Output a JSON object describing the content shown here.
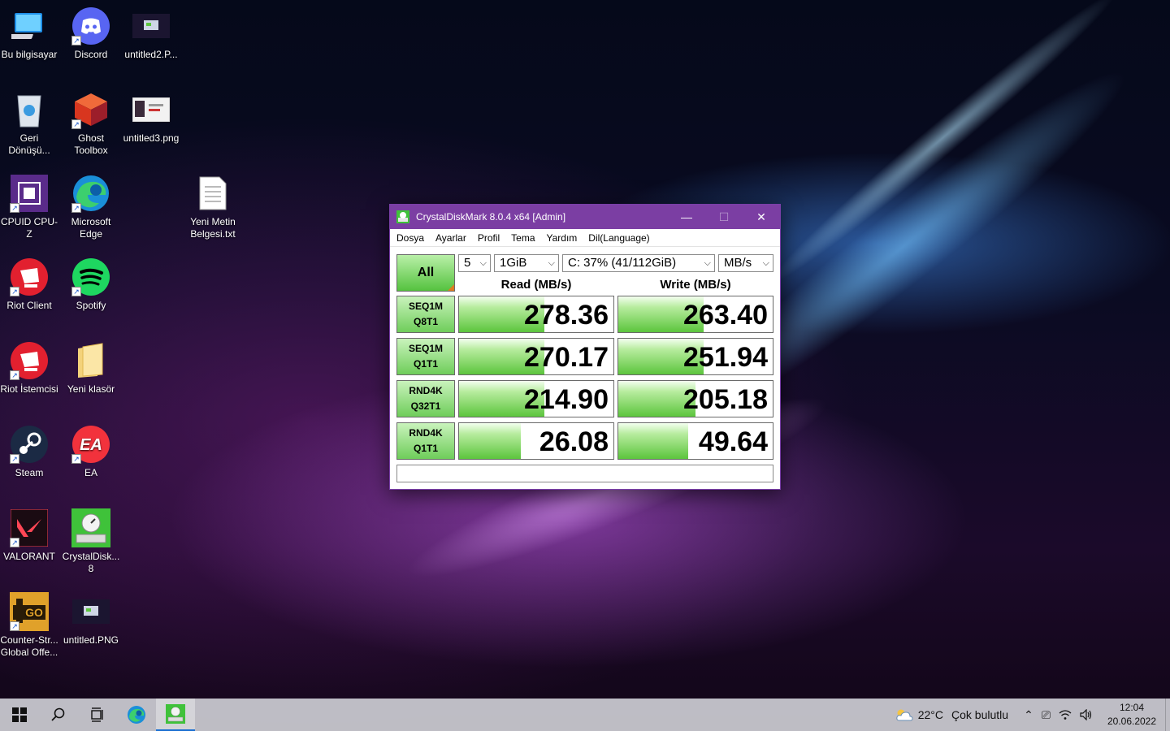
{
  "desktop": {
    "icons": [
      {
        "label": "Bu bilgisayar"
      },
      {
        "label": "Discord"
      },
      {
        "label": "untitled2.P..."
      },
      {
        "label": "Geri Dönüşü..."
      },
      {
        "label": "Ghost Toolbox"
      },
      {
        "label": "untitled3.png"
      },
      {
        "label": "CPUID CPU-Z"
      },
      {
        "label": "Microsoft Edge"
      },
      {
        "label": "Yeni Metin Belgesi.txt"
      },
      {
        "label": "Riot Client"
      },
      {
        "label": "Spotify"
      },
      {
        "label": "Riot İstemcisi"
      },
      {
        "label": "Yeni klasör"
      },
      {
        "label": "Steam"
      },
      {
        "label": "EA"
      },
      {
        "label": "VALORANT"
      },
      {
        "label": "CrystalDisk... 8"
      },
      {
        "label": "Counter-Str... Global Offe..."
      },
      {
        "label": "untitled.PNG"
      }
    ]
  },
  "window": {
    "title": "CrystalDiskMark 8.0.4 x64 [Admin]",
    "menu": [
      "Dosya",
      "Ayarlar",
      "Profil",
      "Tema",
      "Yardım",
      "Dil(Language)"
    ],
    "all_label": "All",
    "count": "5",
    "size": "1GiB",
    "drive": "C: 37% (41/112GiB)",
    "unit": "MB/s",
    "read_header": "Read (MB/s)",
    "write_header": "Write (MB/s)",
    "rows": [
      {
        "line1": "SEQ1M",
        "line2": "Q8T1",
        "read": "278.36",
        "write": "263.40",
        "read_fill": 0.55,
        "write_fill": 0.55
      },
      {
        "line1": "SEQ1M",
        "line2": "Q1T1",
        "read": "270.17",
        "write": "251.94",
        "read_fill": 0.55,
        "write_fill": 0.55
      },
      {
        "line1": "RND4K",
        "line2": "Q32T1",
        "read": "214.90",
        "write": "205.18",
        "read_fill": 0.55,
        "write_fill": 0.5
      },
      {
        "line1": "RND4K",
        "line2": "Q1T1",
        "read": "26.08",
        "write": "49.64",
        "read_fill": 0.4,
        "write_fill": 0.45
      }
    ]
  },
  "taskbar": {
    "temperature": "22°C",
    "weather": "Çok bulutlu",
    "time": "12:04",
    "date": "20.06.2022"
  },
  "colors": {
    "titlebar": "#7b3ea3",
    "bar_green": "#5cc53d",
    "accent_blue": "#1a6fd1"
  }
}
